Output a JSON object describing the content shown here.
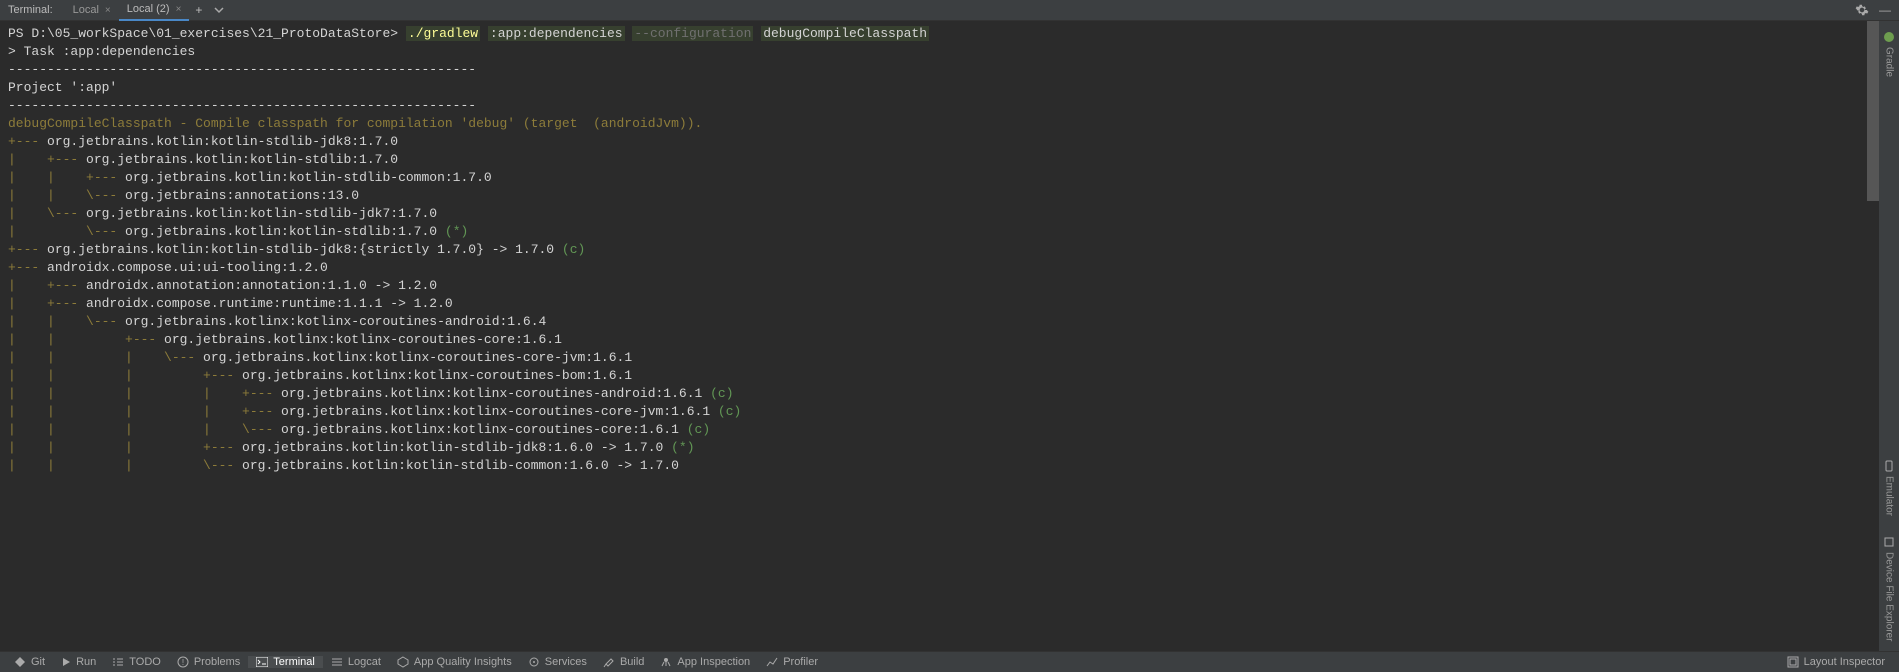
{
  "header": {
    "label": "Terminal:",
    "tabs": [
      {
        "label": "Local",
        "active": false
      },
      {
        "label": "Local (2)",
        "active": true
      }
    ]
  },
  "sideTools": {
    "gradle": "Gradle",
    "emulator": "Emulator",
    "deviceExplorer": "Device File Explorer"
  },
  "prompt": {
    "prefix": "PS ",
    "path": "D:\\05_workSpace\\01_exercises\\21_ProtoDataStore>",
    "cmd": "./gradlew",
    "arg1": ":app:dependencies",
    "opt": "--configuration",
    "arg2": "debugCompileClasspath"
  },
  "output": {
    "blank1": "",
    "task": "> Task :app:dependencies",
    "blank2": "",
    "sep1": "------------------------------------------------------------",
    "project": "Project ':app'",
    "sep2": "------------------------------------------------------------",
    "blank3": "",
    "config": "debugCompileClasspath - Compile classpath for compilation 'debug' (target  (androidJvm)).",
    "lines": [
      {
        "bars": "+--- ",
        "text": "org.jetbrains.kotlin:kotlin-stdlib-jdk8:1.7.0",
        "suffix": ""
      },
      {
        "bars": "|    +--- ",
        "text": "org.jetbrains.kotlin:kotlin-stdlib:1.7.0",
        "suffix": ""
      },
      {
        "bars": "|    |    +--- ",
        "text": "org.jetbrains.kotlin:kotlin-stdlib-common:1.7.0",
        "suffix": ""
      },
      {
        "bars": "|    |    \\--- ",
        "text": "org.jetbrains:annotations:13.0",
        "suffix": ""
      },
      {
        "bars": "|    \\--- ",
        "text": "org.jetbrains.kotlin:kotlin-stdlib-jdk7:1.7.0",
        "suffix": ""
      },
      {
        "bars": "|         \\--- ",
        "text": "org.jetbrains.kotlin:kotlin-stdlib:1.7.0 ",
        "suffix": "(*)"
      },
      {
        "bars": "+--- ",
        "text": "org.jetbrains.kotlin:kotlin-stdlib-jdk8:{strictly 1.7.0} -> 1.7.0 ",
        "suffix": "(c)"
      },
      {
        "bars": "+--- ",
        "text": "androidx.compose.ui:ui-tooling:1.2.0",
        "suffix": ""
      },
      {
        "bars": "|    +--- ",
        "text": "androidx.annotation:annotation:1.1.0 -> 1.2.0",
        "suffix": ""
      },
      {
        "bars": "|    +--- ",
        "text": "androidx.compose.runtime:runtime:1.1.1 -> 1.2.0",
        "suffix": ""
      },
      {
        "bars": "|    |    \\--- ",
        "text": "org.jetbrains.kotlinx:kotlinx-coroutines-android:1.6.4",
        "suffix": ""
      },
      {
        "bars": "|    |         +--- ",
        "text": "org.jetbrains.kotlinx:kotlinx-coroutines-core:1.6.1",
        "suffix": ""
      },
      {
        "bars": "|    |         |    \\--- ",
        "text": "org.jetbrains.kotlinx:kotlinx-coroutines-core-jvm:1.6.1",
        "suffix": ""
      },
      {
        "bars": "|    |         |         +--- ",
        "text": "org.jetbrains.kotlinx:kotlinx-coroutines-bom:1.6.1",
        "suffix": ""
      },
      {
        "bars": "|    |         |         |    +--- ",
        "text": "org.jetbrains.kotlinx:kotlinx-coroutines-android:1.6.1 ",
        "suffix": "(c)"
      },
      {
        "bars": "|    |         |         |    +--- ",
        "text": "org.jetbrains.kotlinx:kotlinx-coroutines-core-jvm:1.6.1 ",
        "suffix": "(c)"
      },
      {
        "bars": "|    |         |         |    \\--- ",
        "text": "org.jetbrains.kotlinx:kotlinx-coroutines-core:1.6.1 ",
        "suffix": "(c)"
      },
      {
        "bars": "|    |         |         +--- ",
        "text": "org.jetbrains.kotlin:kotlin-stdlib-jdk8:1.6.0 -> 1.7.0 ",
        "suffix": "(*)"
      },
      {
        "bars": "|    |         |         \\--- ",
        "text": "org.jetbrains.kotlin:kotlin-stdlib-common:1.6.0 -> 1.7.0",
        "suffix": ""
      }
    ]
  },
  "footer": {
    "git": "Git",
    "run": "Run",
    "todo": "TODO",
    "problems": "Problems",
    "terminal": "Terminal",
    "logcat": "Logcat",
    "appQuality": "App Quality Insights",
    "services": "Services",
    "build": "Build",
    "appInspection": "App Inspection",
    "profiler": "Profiler",
    "layoutInspector": "Layout Inspector"
  }
}
